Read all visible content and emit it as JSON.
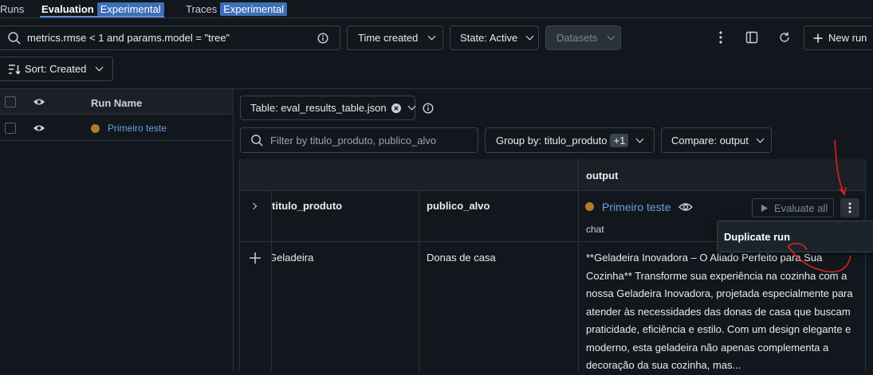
{
  "tabs": {
    "runs": "Runs",
    "evaluation": "Evaluation",
    "evaluation_badge": "Experimental",
    "traces": "Traces",
    "traces_badge": "Experimental"
  },
  "toolbar": {
    "search_value": "metrics.rmse < 1 and params.model = \"tree\"",
    "time_created": "Time created",
    "state": "State: Active",
    "datasets": "Datasets",
    "new_run": "New run",
    "sort": "Sort: Created"
  },
  "runs_table": {
    "header_run_name": "Run Name",
    "rows": [
      {
        "name": "Primeiro teste"
      }
    ]
  },
  "eval": {
    "table_select": "Table: eval_results_table.json",
    "filter_placeholder": "Filter by titulo_produto, publico_alvo",
    "group_by": "Group by: titulo_produto",
    "group_by_count": "+1",
    "compare": "Compare: output",
    "col_output": "output",
    "col_titulo": "titulo_produto",
    "col_publico": "publico_alvo",
    "run_name": "Primeiro teste",
    "run_type": "chat",
    "evaluate_all": "Evaluate all",
    "row_titulo": "Geladeira",
    "row_publico": "Donas de casa",
    "row_output": "**Geladeira Inovadora – O Aliado Perfeito para Sua Cozinha** Transforme sua experiência na cozinha com a nossa Geladeira Inovadora, projetada especialmente para atender às necessidades das donas de casa que buscam praticidade, eficiência e estilo. Com um design elegante e moderno, esta geladeira não apenas complementa a decoração da sua cozinha, mas..."
  },
  "menu": {
    "duplicate_run": "Duplicate run"
  },
  "colors": {
    "accent": "#3c6fb5",
    "link": "#6f9fe0",
    "annotation": "#e02020",
    "run_dot": "#b07a2c"
  }
}
